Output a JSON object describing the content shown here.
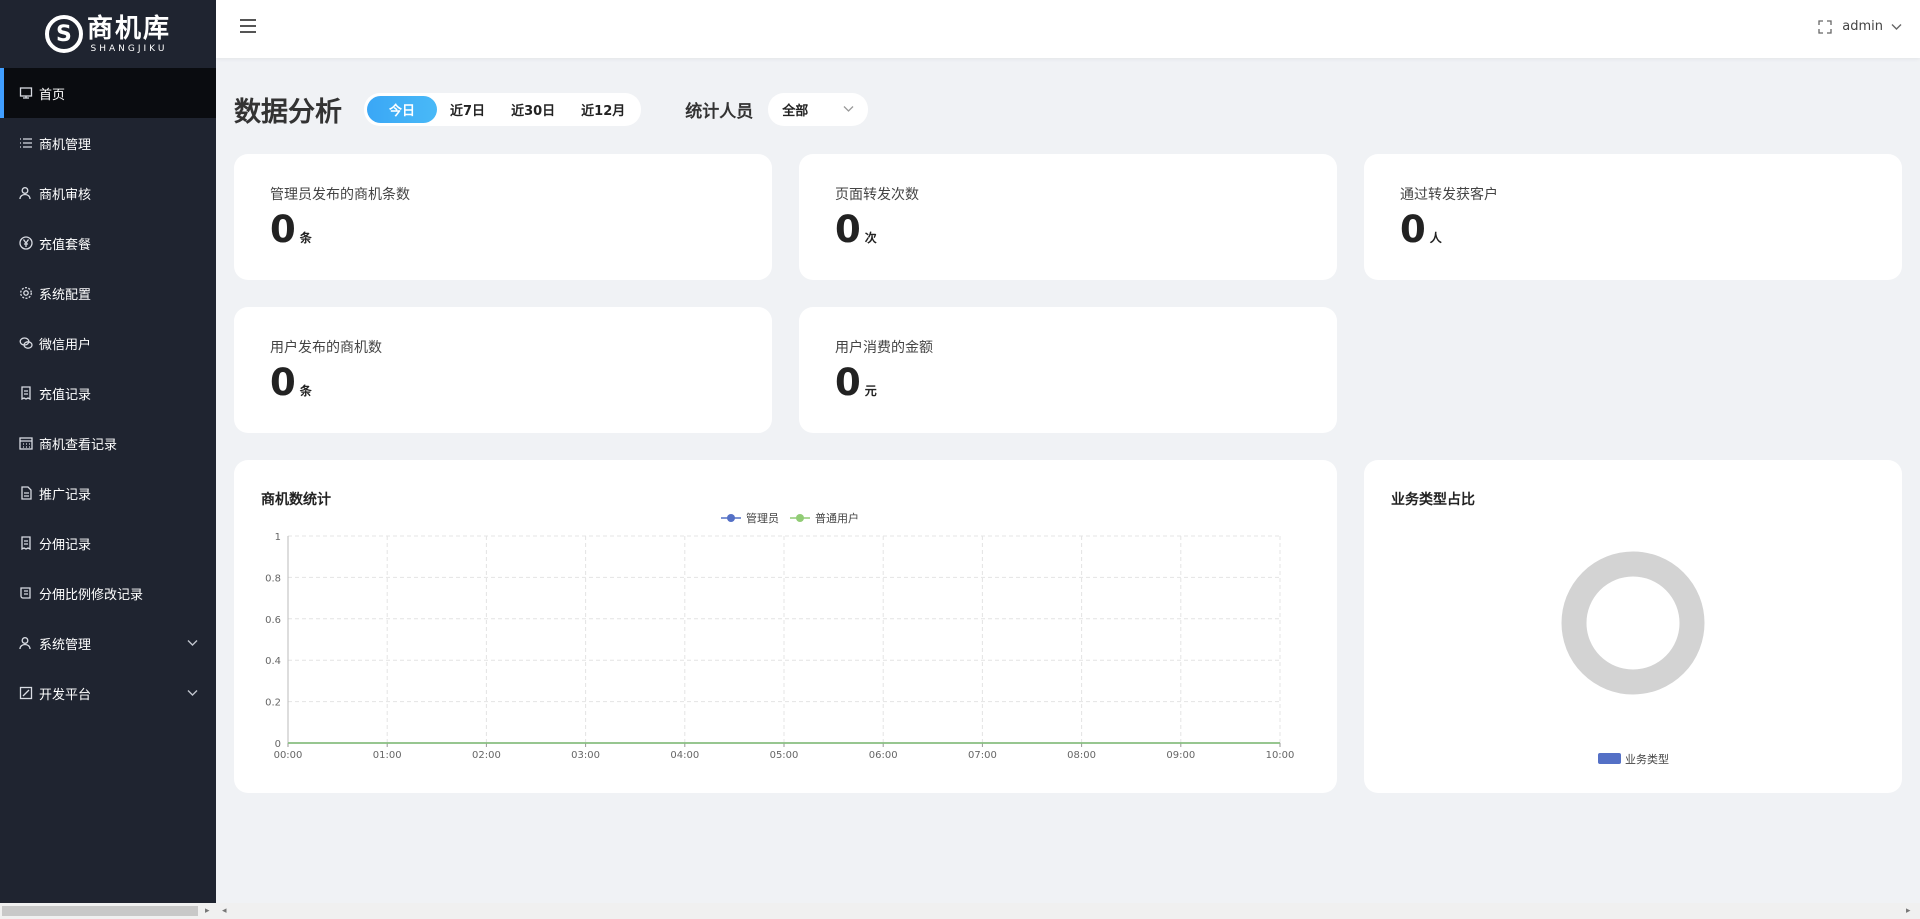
{
  "logo": {
    "cn": "商机库",
    "en": "SHANGJIKU",
    "mark": "S"
  },
  "sidebar": {
    "items": [
      {
        "label": "首页",
        "icon": "dashboard-icon"
      },
      {
        "label": "商机管理",
        "icon": "list-icon"
      },
      {
        "label": "商机审核",
        "icon": "user-check-icon"
      },
      {
        "label": "充值套餐",
        "icon": "yen-icon"
      },
      {
        "label": "系统配置",
        "icon": "gear-icon"
      },
      {
        "label": "微信用户",
        "icon": "wechat-icon"
      },
      {
        "label": "充值记录",
        "icon": "receipt-icon"
      },
      {
        "label": "商机查看记录",
        "icon": "calendar-icon"
      },
      {
        "label": "推广记录",
        "icon": "document-icon"
      },
      {
        "label": "分佣记录",
        "icon": "receipt-icon"
      },
      {
        "label": "分佣比例修改记录",
        "icon": "scroll-icon"
      },
      {
        "label": "系统管理",
        "icon": "user-icon"
      },
      {
        "label": "开发平台",
        "icon": "edit-icon"
      }
    ]
  },
  "header": {
    "username": "admin"
  },
  "main": {
    "title": "数据分析",
    "range_tabs": [
      "今日",
      "近7日",
      "近30日",
      "近12月"
    ],
    "filter_label": "统计人员",
    "filter_value": "全部"
  },
  "stats": [
    {
      "label": "管理员发布的商机条数",
      "value": "0",
      "unit": "条"
    },
    {
      "label": "页面转发次数",
      "value": "0",
      "unit": "次"
    },
    {
      "label": "通过转发获客户",
      "value": "0",
      "unit": "人"
    },
    {
      "label": "用户发布的商机数",
      "value": "0",
      "unit": "条"
    },
    {
      "label": "用户消费的金额",
      "value": "0",
      "unit": "元"
    }
  ],
  "panels": {
    "line_title": "商机数统计",
    "pie_title": "业务类型占比"
  },
  "colors": {
    "admin_series": "#5470c6",
    "user_series": "#91cc75",
    "accent": "#409eff",
    "pie_empty": "#d3d3d3"
  },
  "chart_data": [
    {
      "type": "line",
      "title": "商机数统计",
      "x": [
        "00:00",
        "01:00",
        "02:00",
        "03:00",
        "04:00",
        "05:00",
        "06:00",
        "07:00",
        "08:00",
        "09:00",
        "10:00"
      ],
      "series": [
        {
          "name": "管理员",
          "values": [
            0,
            0,
            0,
            0,
            0,
            0,
            0,
            0,
            0,
            0,
            0
          ]
        },
        {
          "name": "普通用户",
          "values": [
            0,
            0,
            0,
            0,
            0,
            0,
            0,
            0,
            0,
            0,
            0
          ]
        }
      ],
      "yticks": [
        "0",
        "0.2",
        "0.4",
        "0.6",
        "0.8",
        "1"
      ],
      "ylim": [
        0,
        1
      ],
      "grid": true,
      "legend": "top-center"
    },
    {
      "type": "pie",
      "title": "业务类型占比",
      "series": [
        {
          "name": "业务类型",
          "values": []
        }
      ],
      "legend": "bottom-center"
    }
  ]
}
